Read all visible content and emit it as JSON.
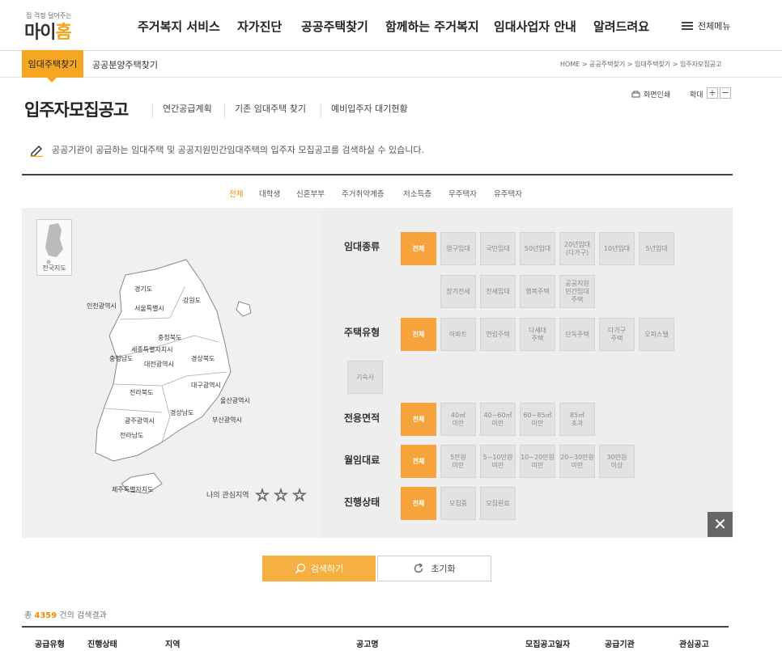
{
  "logo": {
    "tagline": "집 걱정 덜어주는",
    "name_left": "마이",
    "name_right": "홈"
  },
  "gnb": [
    "주거복지 서비스",
    "자가진단",
    "공공주택찾기",
    "함께하는 주거복지",
    "임대사업자 안내",
    "알려드려요"
  ],
  "all_menu_label": "전체메뉴",
  "subnav": {
    "active_tab": "임대주택찾기",
    "other_tab": "공공분양주택찾기"
  },
  "breadcrumb": "HOME > 공공주택찾기 > 임대주택찾기 > 입주자모집공고",
  "tools": {
    "print": "화면인쇄",
    "zoom": "확대",
    "zoom_in": "+",
    "zoom_out": "−"
  },
  "page_title": "입주자모집공고",
  "title_links": [
    "연간공급계획",
    "기존 임대주택 찾기",
    "예비입주자 대기현황"
  ],
  "description": "공공기관이 공급하는 임대주택 및 공공지원민간임대주택의 입주자 모집공고를 검색하실 수 있습니다.",
  "categories": [
    "전체",
    "대학생",
    "신혼부부",
    "주거취약계층",
    "저소득층",
    "무주택자",
    "유주택자"
  ],
  "map": {
    "mini_label": "전국지도",
    "regions": [
      "경기도",
      "인천광역시",
      "서울특별시",
      "강원도",
      "충청북도",
      "세종특별자치시",
      "충청남도",
      "대전광역시",
      "경상북도",
      "대구광역시",
      "전라북도",
      "울산광역시",
      "경상남도",
      "부산광역시",
      "광주광역시",
      "전라남도",
      "제주특별자치도"
    ],
    "favorites_label": "나의 관심지역",
    "star_labels": [
      "1",
      "2",
      "3"
    ]
  },
  "filters": {
    "rental_type": {
      "label": "임대종류",
      "options": [
        "전체",
        "영구임대",
        "국민임대",
        "50년임대",
        "20년임대\n(다가구)",
        "10년임대",
        "5년임대",
        "장기전세",
        "전세임대",
        "행복주택",
        "공공지원\n민간임대\n주택"
      ]
    },
    "housing_type": {
      "label": "주택유형",
      "options": [
        "전체",
        "아파트",
        "연립주택",
        "다세대\n주택",
        "단독주택",
        "다가구\n주택",
        "오피스텔",
        "기숙사"
      ]
    },
    "area": {
      "label": "전용면적",
      "options": [
        "전체",
        "40㎡\n미만",
        "40~60㎡\n미만",
        "60~85㎡\n미만",
        "85㎡\n초과"
      ]
    },
    "rent": {
      "label": "월임대료",
      "options": [
        "전체",
        "5만원\n미만",
        "5~10만원\n미만",
        "10~20만원\n미만",
        "20~30만원\n미만",
        "30만원\n이상"
      ]
    },
    "status": {
      "label": "진행상태",
      "options": [
        "전체",
        "모집중",
        "모집완료"
      ]
    }
  },
  "buttons": {
    "search": "검색하기",
    "reset": "초기화"
  },
  "result": {
    "prefix": "총",
    "count": "4359",
    "suffix": "건의 검색결과"
  },
  "table_headers": [
    "공급유형",
    "진행상태",
    "지역",
    "공고명",
    "모집공고일자",
    "공급기관",
    "관심공고"
  ],
  "colors": {
    "accent": "#f5a623",
    "button": "#f5b041"
  }
}
